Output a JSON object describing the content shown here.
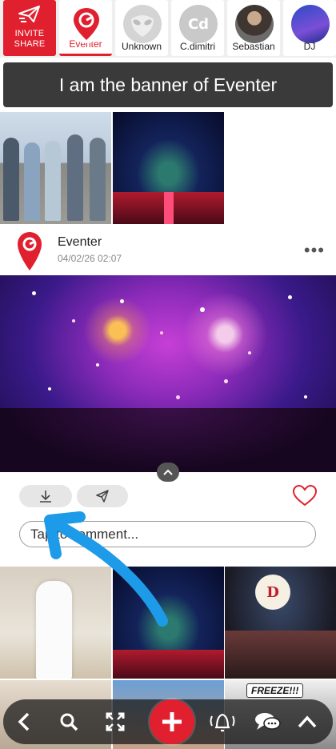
{
  "top_strip": {
    "invite": {
      "line1": "INVITE",
      "line2": "SHARE",
      "icon": "send-plane-icon"
    },
    "stories": [
      {
        "label": "Eventer",
        "active": true
      },
      {
        "label": "Unknown",
        "active": false
      },
      {
        "label": "C.dimitri",
        "initials": "Cd",
        "active": false
      },
      {
        "label": "Sebastian",
        "active": false
      },
      {
        "label": "DJ",
        "active": false
      }
    ]
  },
  "banner": {
    "text": "I am the banner of Eventer"
  },
  "post": {
    "author": "Eventer",
    "timestamp": "04/02/26 02:07",
    "menu_icon": "more-dots-icon",
    "actions": {
      "download_icon": "download-icon",
      "share_icon": "send-icon",
      "like_icon": "heart-icon"
    },
    "comment_placeholder": "Tap to comment..."
  },
  "grid": {
    "freeze_label": "FREEZE!!!",
    "balloon_letter": "D"
  },
  "bottom_bar": {
    "items": [
      "back-icon",
      "search-icon",
      "expand-icon",
      "add-icon",
      "bell-icon",
      "chat-icon",
      "chevron-up-icon"
    ]
  },
  "colors": {
    "brand_red": "#e0202e",
    "guide_arrow": "#1e9be8"
  }
}
